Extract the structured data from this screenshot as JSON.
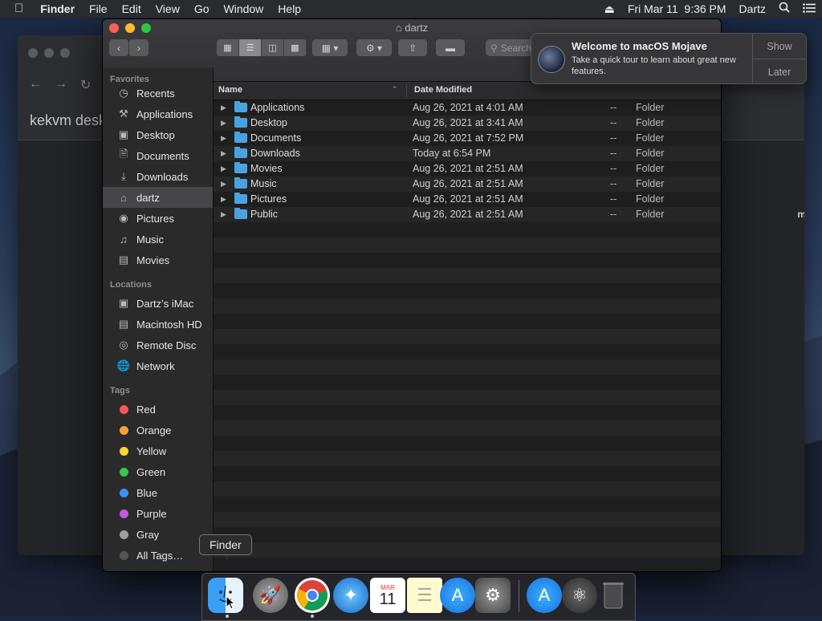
{
  "menubar": {
    "app_name": "Finder",
    "menus": [
      "File",
      "Edit",
      "View",
      "Go",
      "Window",
      "Help"
    ],
    "clock": "Fri Mar 11  9:36 PM",
    "user": "Dartz"
  },
  "background_window": {
    "page_text": "kekvm desk",
    "edge_letter": "m"
  },
  "finder": {
    "title": "dartz",
    "search_placeholder": "Search",
    "sidebar": {
      "favorites_header": "Favorites",
      "favorites": [
        {
          "label": "Recents",
          "icon": "clock-icon"
        },
        {
          "label": "Applications",
          "icon": "applications-icon"
        },
        {
          "label": "Desktop",
          "icon": "desktop-icon"
        },
        {
          "label": "Documents",
          "icon": "documents-icon"
        },
        {
          "label": "Downloads",
          "icon": "downloads-icon"
        },
        {
          "label": "dartz",
          "icon": "home-icon"
        },
        {
          "label": "Pictures",
          "icon": "camera-icon"
        },
        {
          "label": "Music",
          "icon": "music-icon"
        },
        {
          "label": "Movies",
          "icon": "film-icon"
        }
      ],
      "locations_header": "Locations",
      "locations": [
        {
          "label": "Dartz’s iMac",
          "icon": "imac-icon"
        },
        {
          "label": "Macintosh HD",
          "icon": "disk-icon"
        },
        {
          "label": "Remote Disc",
          "icon": "disc-icon"
        },
        {
          "label": "Network",
          "icon": "network-icon"
        }
      ],
      "tags_header": "Tags",
      "tags": [
        {
          "label": "Red",
          "color": "#fc5753"
        },
        {
          "label": "Orange",
          "color": "#fda033"
        },
        {
          "label": "Yellow",
          "color": "#fed42f"
        },
        {
          "label": "Green",
          "color": "#34c84a"
        },
        {
          "label": "Blue",
          "color": "#3b8ff7"
        },
        {
          "label": "Purple",
          "color": "#bd5ce0"
        },
        {
          "label": "Gray",
          "color": "#a0a0a0"
        },
        {
          "label": "All Tags…",
          "color": "#555555"
        }
      ]
    },
    "columns": {
      "name": "Name",
      "date": "Date Modified"
    },
    "files": [
      {
        "name": "Applications",
        "date": "Aug 26, 2021 at 4:01 AM",
        "size": "--",
        "kind": "Folder"
      },
      {
        "name": "Desktop",
        "date": "Aug 26, 2021 at 3:41 AM",
        "size": "--",
        "kind": "Folder"
      },
      {
        "name": "Documents",
        "date": "Aug 26, 2021 at 7:52 PM",
        "size": "--",
        "kind": "Folder"
      },
      {
        "name": "Downloads",
        "date": "Today at 6:54 PM",
        "size": "--",
        "kind": "Folder"
      },
      {
        "name": "Movies",
        "date": "Aug 26, 2021 at 2:51 AM",
        "size": "--",
        "kind": "Folder"
      },
      {
        "name": "Music",
        "date": "Aug 26, 2021 at 2:51 AM",
        "size": "--",
        "kind": "Folder"
      },
      {
        "name": "Pictures",
        "date": "Aug 26, 2021 at 2:51 AM",
        "size": "--",
        "kind": "Folder"
      },
      {
        "name": "Public",
        "date": "Aug 26, 2021 at 2:51 AM",
        "size": "--",
        "kind": "Folder"
      }
    ]
  },
  "notification": {
    "title": "Welcome to macOS Mojave",
    "body": "Take a quick tour to learn about great new features.",
    "show_label": "Show",
    "later_label": "Later"
  },
  "dock": {
    "tooltip": "Finder",
    "calendar_month": "MAR",
    "calendar_day": "11",
    "apps": [
      "finder-icon",
      "launchpad-icon",
      "chrome-icon",
      "safari-icon",
      "calendar-icon",
      "notes-icon",
      "app-store-icon",
      "system-preferences-icon",
      "app-store-icon",
      "atom-icon",
      "trash-icon"
    ]
  }
}
